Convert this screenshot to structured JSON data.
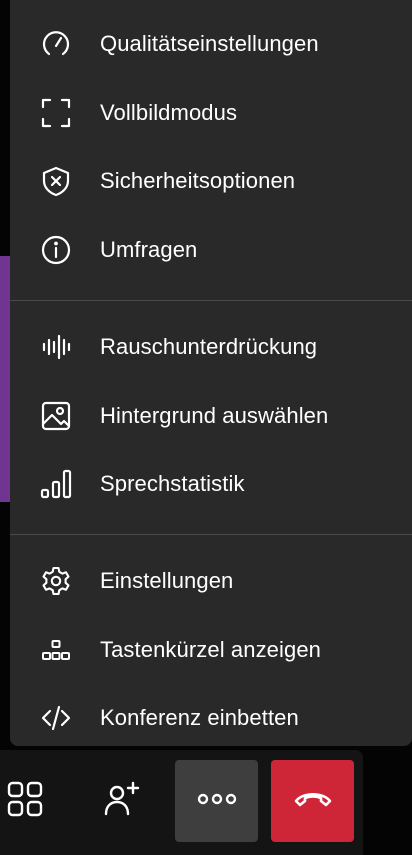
{
  "menu": {
    "items": [
      {
        "label": "Qualitätseinstellungen",
        "icon": "gauge-icon"
      },
      {
        "label": "Vollbildmodus",
        "icon": "fullscreen-icon"
      },
      {
        "label": "Sicherheitsoptionen",
        "icon": "shield-x-icon"
      },
      {
        "label": "Umfragen",
        "icon": "info-circle-icon"
      },
      {
        "label": "Rauschunterdrückung",
        "icon": "waveform-icon"
      },
      {
        "label": "Hintergrund auswählen",
        "icon": "image-icon"
      },
      {
        "label": "Sprechstatistik",
        "icon": "bar-stats-icon"
      },
      {
        "label": "Einstellungen",
        "icon": "gear-icon"
      },
      {
        "label": "Tastenkürzel anzeigen",
        "icon": "shortcuts-icon"
      },
      {
        "label": "Konferenz einbetten",
        "icon": "code-icon"
      }
    ]
  },
  "toolbar": {
    "buttons": [
      {
        "name": "tile-view",
        "icon": "grid-icon"
      },
      {
        "name": "invite",
        "icon": "add-person-icon"
      },
      {
        "name": "more",
        "icon": "more-dots-icon"
      },
      {
        "name": "hangup",
        "icon": "hangup-icon"
      }
    ]
  },
  "colors": {
    "menu_bg": "#292929",
    "text": "#ffffff",
    "hangup": "#cf2637",
    "more_active": "#3e3e3e",
    "accent_purple": "#6f3590"
  }
}
